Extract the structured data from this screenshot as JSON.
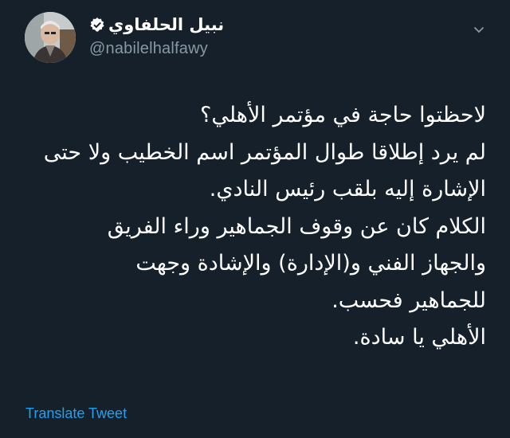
{
  "tweet": {
    "author": {
      "display_name": "نبيل الحلفاوي",
      "handle": "@nabilelhalfawy",
      "verified": true,
      "avatar_icon": "profile-photo"
    },
    "menu_icon": "chevron-down-icon",
    "lines": [
      "لاحظتوا حاجة في مؤتمر الأهلي؟",
      "لم يرد إطلاقا طوال المؤتمر اسم الخطيب ولا حتى",
      "الإشارة إليه بلقب رئيس النادي.",
      "الكلام كان عن وقوف الجماهير وراء الفريق",
      "والجهاز الفني و(الإدارة) والإشادة وجهت",
      "للجماهير فحسب.",
      "الأهلي يا سادة."
    ],
    "translate_label": "Translate Tweet"
  },
  "colors": {
    "background": "#15202b",
    "text": "#ffffff",
    "muted": "#8899a6",
    "accent": "#1da1f2"
  }
}
